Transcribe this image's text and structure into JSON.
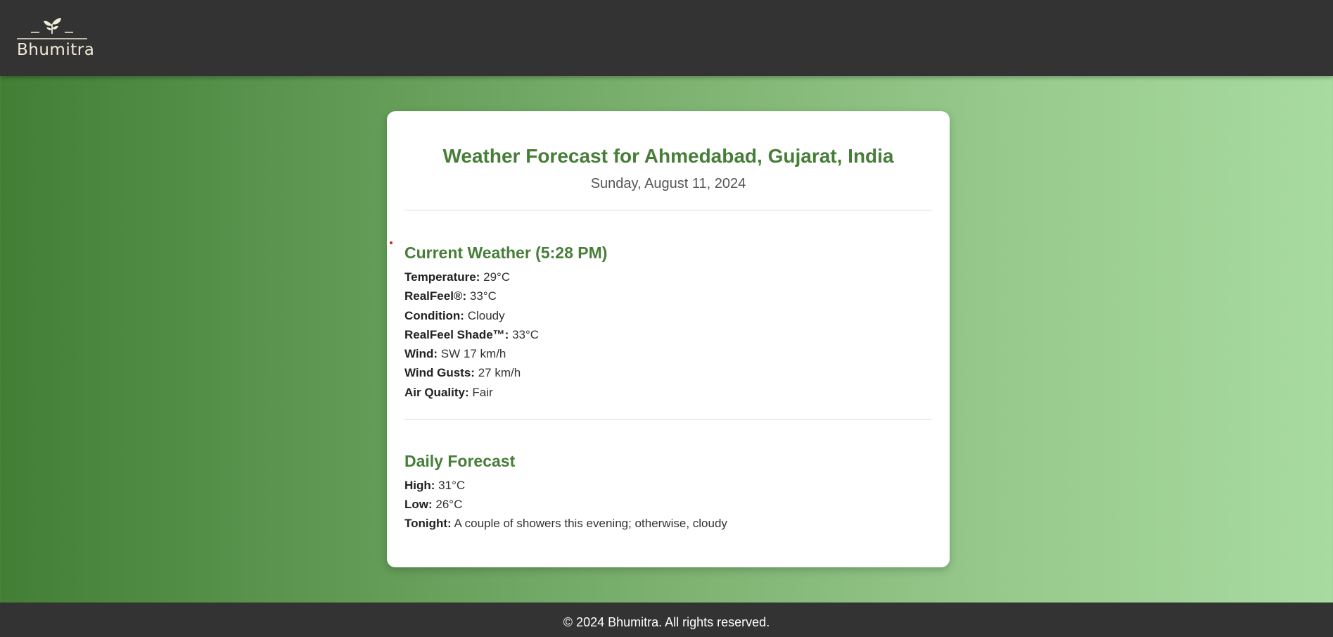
{
  "header": {
    "logo_text": "Bhumitra",
    "logo_icon": "sprout-icon"
  },
  "forecast": {
    "title": "Weather Forecast for Ahmedabad, Gujarat, India",
    "date": "Sunday, August 11, 2024",
    "current": {
      "heading": "Current Weather (5:28 PM)",
      "rows": [
        {
          "label": "Temperature:",
          "value": "29°C"
        },
        {
          "label": "RealFeel®:",
          "value": "33°C"
        },
        {
          "label": "Condition:",
          "value": "Cloudy"
        },
        {
          "label": "RealFeel Shade™:",
          "value": "33°C"
        },
        {
          "label": "Wind:",
          "value": "SW 17 km/h"
        },
        {
          "label": "Wind Gusts:",
          "value": "27 km/h"
        },
        {
          "label": "Air Quality:",
          "value": "Fair"
        }
      ]
    },
    "daily": {
      "heading": "Daily Forecast",
      "rows": [
        {
          "label": "High:",
          "value": "31°C"
        },
        {
          "label": "Low:",
          "value": "26°C"
        },
        {
          "label": "Tonight:",
          "value": "A couple of showers this evening; otherwise, cloudy"
        }
      ]
    }
  },
  "footer": {
    "text": "© 2024 Bhumitra. All rights reserved."
  },
  "colors": {
    "header_bg": "#333333",
    "accent_green": "#467e38",
    "card_bg": "#ffffff"
  }
}
